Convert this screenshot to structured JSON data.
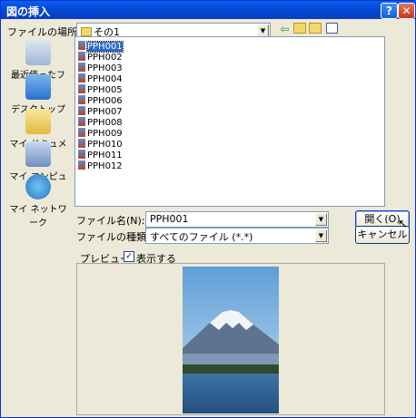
{
  "window": {
    "title": "図の挿入"
  },
  "location": {
    "label": "ファイルの場所(I):",
    "value": "その1"
  },
  "places": [
    {
      "label": "最近使ったファイル",
      "icon": "recent-documents-icon"
    },
    {
      "label": "デスクトップ",
      "icon": "desktop-icon"
    },
    {
      "label": "マイ ドキュメント",
      "icon": "my-documents-icon"
    },
    {
      "label": "マイ コンピュータ",
      "icon": "my-computer-icon"
    },
    {
      "label": "マイ ネットワーク",
      "icon": "my-network-icon"
    }
  ],
  "files": [
    "PPH001",
    "PPH002",
    "PPH003",
    "PPH004",
    "PPH005",
    "PPH006",
    "PPH007",
    "PPH008",
    "PPH009",
    "PPH010",
    "PPH011",
    "PPH012"
  ],
  "selected_file": "PPH001",
  "filename": {
    "label": "ファイル名(N):",
    "value": "PPH001"
  },
  "filetype": {
    "label": "ファイルの種類(T):",
    "value": "すべてのファイル (*.*)"
  },
  "buttons": {
    "open": "開く(O)",
    "cancel": "キャンセル"
  },
  "preview": {
    "label": "プレビュー",
    "checkbox_label": "表示する",
    "checked": true,
    "check_mark": "✓"
  },
  "toolbar_icons": [
    "back-icon",
    "up-folder-icon",
    "new-folder-icon",
    "views-menu-icon"
  ],
  "titlebar_buttons": {
    "help": "?",
    "close": "✕"
  }
}
